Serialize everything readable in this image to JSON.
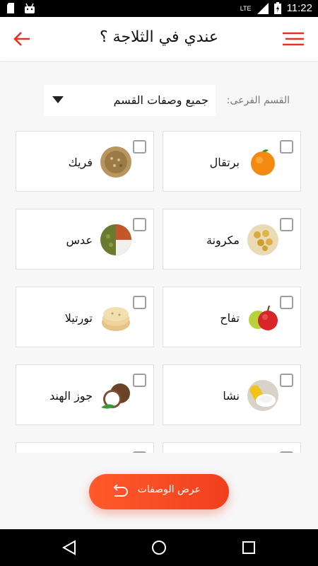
{
  "status": {
    "time": "11:22",
    "network": "LTE"
  },
  "header": {
    "title": "عندي في الثلاجة ؟"
  },
  "filter": {
    "label": "القسم الفرعى:",
    "selected": "جميع وصفات القسم"
  },
  "items": [
    {
      "name": "برتقال",
      "icon": "orange-icon",
      "checked": false
    },
    {
      "name": "فريك",
      "icon": "freekeh-icon",
      "checked": false
    },
    {
      "name": "مكرونة",
      "icon": "pasta-icon",
      "checked": false
    },
    {
      "name": "عدس",
      "icon": "lentils-icon",
      "checked": false
    },
    {
      "name": "تفاح",
      "icon": "apple-icon",
      "checked": false
    },
    {
      "name": "تورتيلا",
      "icon": "tortilla-icon",
      "checked": false
    },
    {
      "name": "نشا",
      "icon": "starch-icon",
      "checked": false
    },
    {
      "name": "جوز الهند",
      "icon": "coconut-icon",
      "checked": false
    }
  ],
  "action": {
    "label": "عرض الوصفات"
  },
  "colors": {
    "accent": "#e8311c",
    "fab": "#f2461f"
  }
}
